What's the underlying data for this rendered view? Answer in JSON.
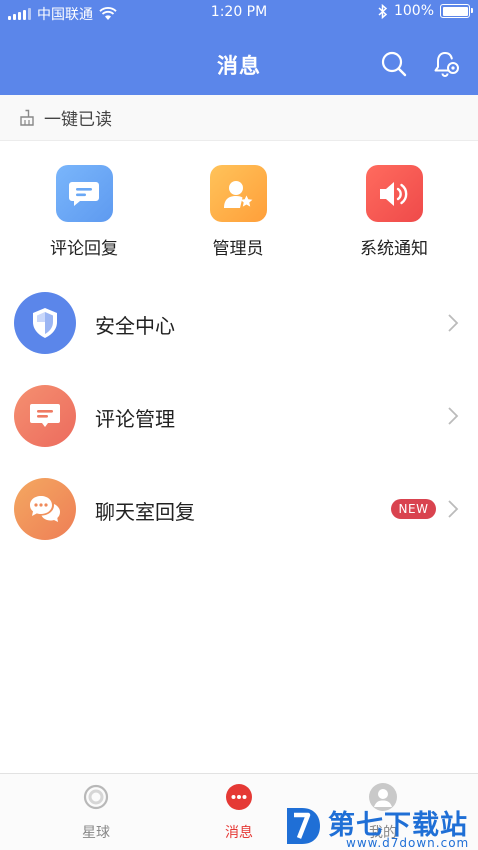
{
  "status_bar": {
    "carrier": "中国联通",
    "time": "1:20 PM",
    "battery": "100%"
  },
  "nav": {
    "title": "消息"
  },
  "read_all": {
    "label": "一键已读"
  },
  "quick_actions": [
    {
      "label": "评论回复",
      "icon": "comment-icon",
      "color": "#6aa8f5"
    },
    {
      "label": "管理员",
      "icon": "admin-icon",
      "color": "#ffb24a"
    },
    {
      "label": "系统通知",
      "icon": "speaker-icon",
      "color": "#f25a53"
    }
  ],
  "list": [
    {
      "label": "安全中心",
      "icon": "shield-icon",
      "color": "#5b86ea"
    },
    {
      "label": "评论管理",
      "icon": "comment-icon",
      "color": "#f07e65"
    },
    {
      "label": "聊天室回复",
      "icon": "chat-icon",
      "color": "#f09a5e",
      "badge": "NEW"
    }
  ],
  "tabbar": {
    "items": [
      {
        "label": "星球",
        "icon": "planet-icon"
      },
      {
        "label": "消息",
        "icon": "message-icon",
        "active": true
      },
      {
        "label": "我的",
        "icon": "profile-icon"
      }
    ],
    "active_color": "#e53935"
  },
  "watermark": {
    "text": "第七下载站",
    "url": "www.d7down.com"
  },
  "colors": {
    "primary": "#5b86ea"
  }
}
